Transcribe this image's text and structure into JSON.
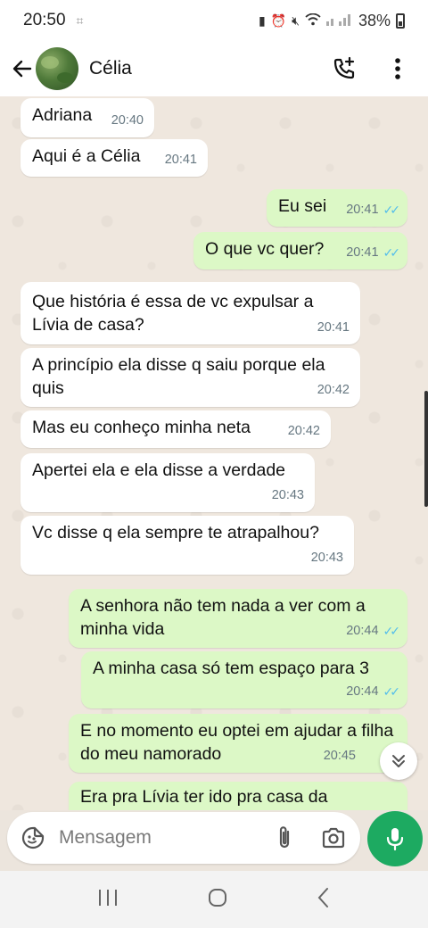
{
  "status_bar": {
    "time": "20:50",
    "battery": "38%"
  },
  "header": {
    "contact_name": "Célia"
  },
  "messages": [
    {
      "dir": "in",
      "text": "Adriana",
      "time": "20:40",
      "read": false
    },
    {
      "dir": "in",
      "text": "Aqui é a Célia",
      "time": "20:41",
      "read": false
    },
    {
      "dir": "out",
      "text": "Eu sei",
      "time": "20:41",
      "read": true
    },
    {
      "dir": "out",
      "text": "O que vc quer?",
      "time": "20:41",
      "read": true
    },
    {
      "dir": "in",
      "text": "Que história é essa de vc expulsar a Lívia de casa?",
      "time": "20:41",
      "read": false
    },
    {
      "dir": "in",
      "text": "A princípio ela disse q saiu porque ela quis",
      "time": "20:42",
      "read": false
    },
    {
      "dir": "in",
      "text": "Mas eu conheço minha neta",
      "time": "20:42",
      "read": false
    },
    {
      "dir": "in",
      "text": "Apertei ela e ela disse a verdade",
      "time": "20:43",
      "read": false
    },
    {
      "dir": "in",
      "text": "Vc disse q ela sempre te atrapalhou?",
      "time": "20:43",
      "read": false
    },
    {
      "dir": "out",
      "text": "A senhora não tem nada a ver com a minha vida",
      "time": "20:44",
      "read": true
    },
    {
      "dir": "out",
      "text": "A minha casa só tem espaço para 3",
      "time": "20:44",
      "read": true
    },
    {
      "dir": "out",
      "text": "E no momento eu optei em ajudar a filha do meu namorado",
      "time": "20:45",
      "read": false
    },
    {
      "dir": "out",
      "text": "Era pra Lívia ter ido pra casa da",
      "time": "",
      "read": false
    }
  ],
  "composer": {
    "placeholder": "Mensagem"
  },
  "colors": {
    "outgoing_bubble": "#dcf8c6",
    "incoming_bubble": "#ffffff",
    "accent_green": "#1daa61",
    "read_ticks": "#53bdeb"
  },
  "icons": {
    "back": "arrow-left-icon",
    "add_call": "phone-plus-icon",
    "menu": "more-vertical-icon",
    "sticker": "sticker-icon",
    "attach": "paperclip-icon",
    "camera": "camera-icon",
    "mic": "microphone-icon",
    "scroll": "double-chevron-down-icon"
  }
}
